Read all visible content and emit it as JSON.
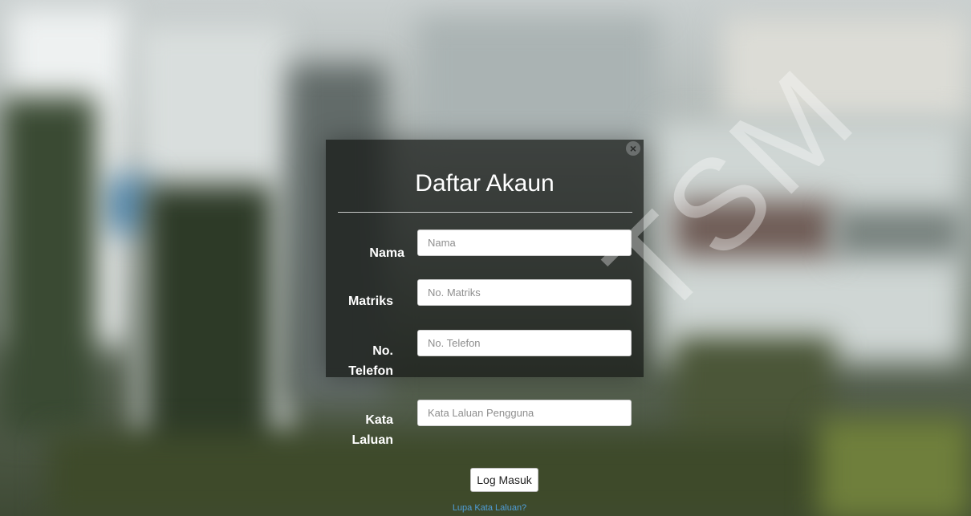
{
  "form": {
    "title": "Daftar Akaun",
    "fields": [
      {
        "label": "Nama",
        "placeholder": "Nama",
        "value": ""
      },
      {
        "label": "Matriks",
        "placeholder": "No. Matriks",
        "value": ""
      },
      {
        "label_line1": "No.",
        "label_line2": "Telefon",
        "placeholder": "No. Telefon",
        "value": ""
      },
      {
        "label_line1": "Kata",
        "label_line2": "Laluan",
        "placeholder": "Kata Laluan Pengguna",
        "value": ""
      }
    ],
    "submit_label": "Log Masuk",
    "forgot_label": "Lupa Kata Laluan?",
    "close_symbol": "×"
  },
  "watermark": "TSM",
  "icons": {
    "close": "close-icon"
  },
  "colors": {
    "link": "#4f9ed8",
    "panel": "#141614",
    "title_text": "#ffffff"
  }
}
